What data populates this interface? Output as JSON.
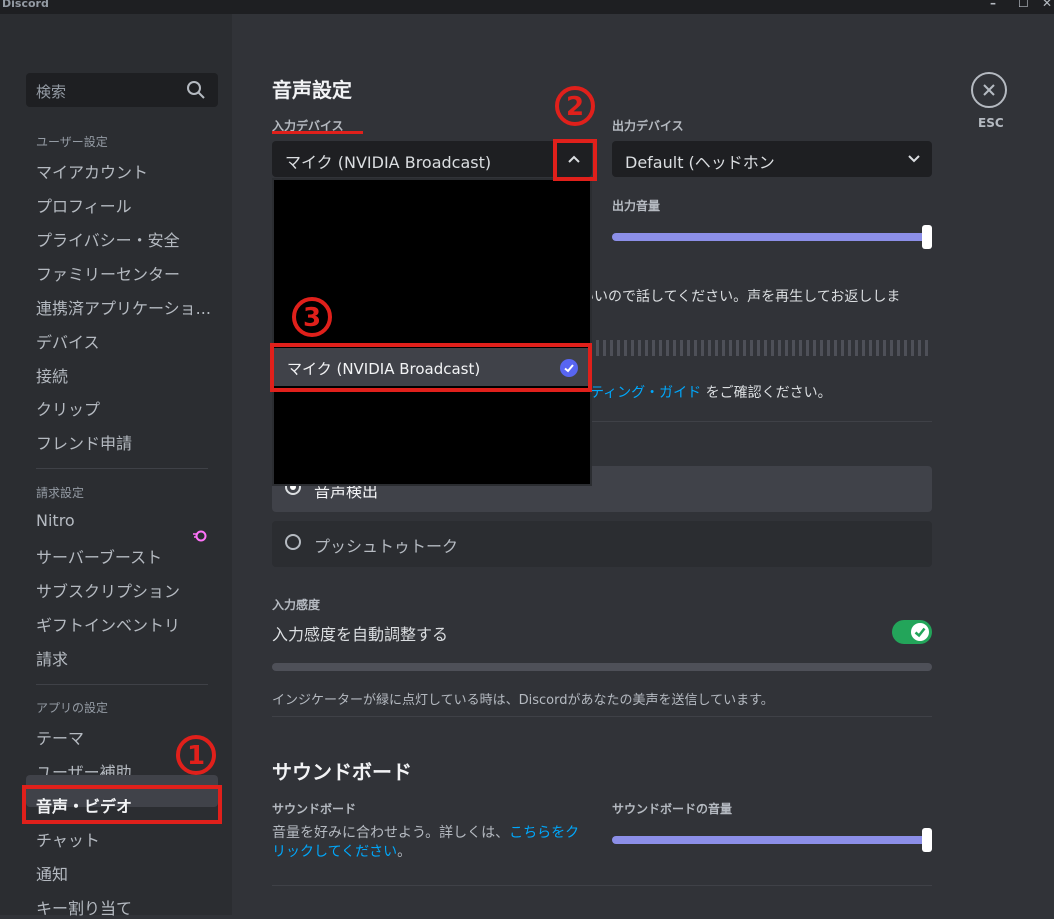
{
  "titlebar": {
    "app_name": "Discord",
    "min": "–",
    "max": "☐",
    "close": "✕"
  },
  "search": {
    "placeholder": "検索"
  },
  "sidebar": {
    "user_settings_header": "ユーザー設定",
    "user_items": [
      "マイアカウント",
      "プロフィール",
      "プライバシー・安全",
      "ファミリーセンター",
      "連携済アプリケーショ...",
      "デバイス",
      "接続",
      "クリップ",
      "フレンド申請"
    ],
    "billing_header": "請求設定",
    "billing_items": [
      "Nitro",
      "サーバーブースト",
      "サブスクリプション",
      "ギフトインベントリ",
      "請求"
    ],
    "app_header": "アプリの設定",
    "app_items": [
      "テーマ",
      "ユーザー補助",
      "音声・ビデオ",
      "チャット",
      "通知",
      "キー割り当て"
    ],
    "active_item": "音声・ビデオ"
  },
  "main": {
    "title": "音声設定",
    "input_device_label": "入力デバイス",
    "input_device_value": "マイク (NVIDIA Broadcast)",
    "output_device_label": "出力デバイス",
    "output_device_value": "Default (ヘッドホン",
    "output_volume_label": "出力音量",
    "output_volume": 1.0,
    "mic_test_text": "いいので話してください。声を再生してお返ししま",
    "troubleshoot_link": "ティング・ガイド",
    "troubleshoot_suffix": "をご確認ください。",
    "input_mode_voice": "音声検出",
    "input_mode_ptt": "プッシュトゥトーク",
    "sensitivity_header": "入力感度",
    "sensitivity_auto_label": "入力感度を自動調整する",
    "sensitivity_auto_enabled": true,
    "sensitivity_note": "インジケーターが緑に点灯している時は、Discordがあなたの美声を送信しています。",
    "soundboard_title": "サウンドボード",
    "soundboard_label": "サウンドボード",
    "soundboard_desc_1": "音量を好みに合わせよう。詳しくは、",
    "soundboard_link": "こちらをクリックしてください",
    "soundboard_desc_end": "。",
    "soundboard_volume_label": "サウンドボードの音量",
    "soundboard_volume": 1.0,
    "esc_label": "ESC"
  },
  "dropdown": {
    "selected_option": "マイク (NVIDIA Broadcast)"
  },
  "annotations": {
    "one": "1",
    "two": "2",
    "three": "3"
  },
  "colors": {
    "accent": "#5865f2",
    "annotation_red": "#e0201b",
    "toggle_on": "#23a55a",
    "link": "#00a8fc"
  }
}
